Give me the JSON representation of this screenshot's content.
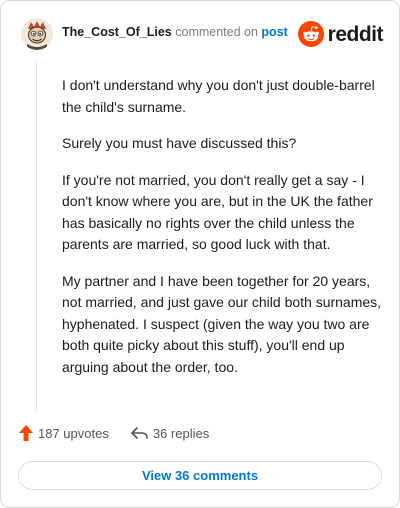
{
  "header": {
    "username": "The_Cost_Of_Lies",
    "action_text": "commented on",
    "post_link": "post"
  },
  "logo": {
    "wordmark": "reddit",
    "icon": "reddit-alien-icon",
    "brand_color": "#ff4500"
  },
  "comment": {
    "paragraphs": [
      "I don't understand why you don't just double-barrel the child's surname.",
      "Surely you must have discussed this?",
      "If you're not married, you don't really get a say - I don't know where you are, but in the UK the father has basically no rights over the child unless the parents are married, so good luck with that.",
      "My partner and I have been together for 20 years, not married, and just gave our child both surnames, hyphenated. I suspect (given the way you two are both quite picky about this stuff), you'll end up arguing about the order, too."
    ]
  },
  "footer": {
    "upvotes": "187 upvotes",
    "replies": "36 replies",
    "upvote_icon": "upvote-arrow-icon",
    "reply_icon": "reply-arrow-icon",
    "upvote_color": "#ff4500"
  },
  "cta": {
    "label": "View 36 comments",
    "color": "#0079d3"
  }
}
